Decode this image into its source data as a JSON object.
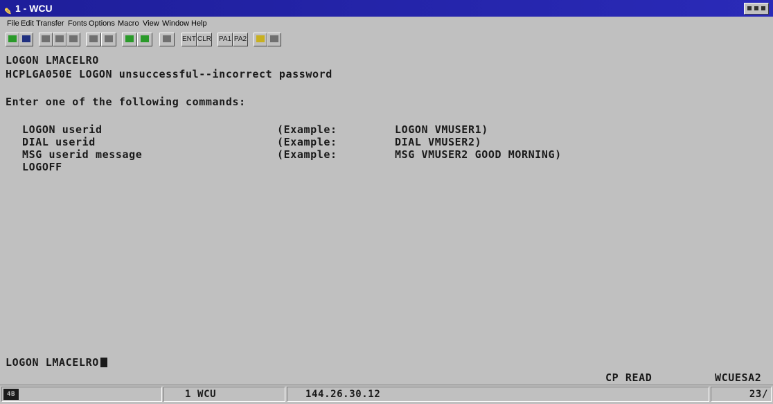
{
  "window": {
    "title": "1 - WCU"
  },
  "menu": {
    "items": [
      "File",
      "Edit",
      "Transfer",
      "Fonts",
      "Options",
      "Macro",
      "View",
      "Window",
      "Help"
    ]
  },
  "toolbar": {
    "buttons": [
      "copy-paste",
      "save",
      "cut",
      "copy",
      "paste",
      "font-up",
      "font-dn",
      "send",
      "receive",
      "print",
      "ENT",
      "CLR",
      "PA1",
      "PA2",
      "help",
      "stop"
    ],
    "ent": "ENT",
    "clr": "CLR",
    "pa1": "PA1",
    "pa2": "PA2"
  },
  "terminal": {
    "line1": "LOGON LMACELRO",
    "line2": "HCPLGA050E LOGON unsuccessful--incorrect password",
    "line3": "Enter one of the following commands:",
    "commands": [
      {
        "cmd": "LOGON userid",
        "example_label": "(Example:",
        "example": "LOGON VMUSER1)"
      },
      {
        "cmd": "DIAL userid",
        "example_label": "(Example:",
        "example": "DIAL VMUSER2)"
      },
      {
        "cmd": "MSG userid message",
        "example_label": "(Example:",
        "example": "MSG VMUSER2 GOOD MORNING)"
      },
      {
        "cmd": "LOGOFF",
        "example_label": "",
        "example": ""
      }
    ],
    "input_line": "LOGON LMACELRO",
    "status_left": "CP READ",
    "status_right": "WCUESA2"
  },
  "statusbar": {
    "indicator": "4B",
    "session": "1 WCU",
    "ip": "144.26.30.12",
    "cursor_pos": "23/"
  }
}
